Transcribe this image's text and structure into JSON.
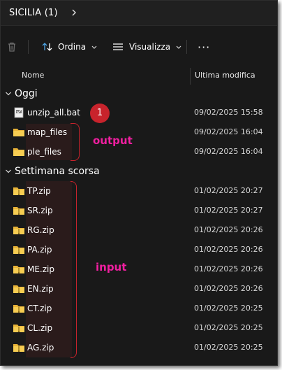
{
  "breadcrumb": {
    "folder": "SICILIA (1)"
  },
  "toolbar": {
    "sort_label": "Ordina",
    "view_label": "Visualizza",
    "more_label": "···"
  },
  "columns": {
    "name": "Nome",
    "modified": "Ultima modifica"
  },
  "groups": [
    {
      "label": "Oggi",
      "items": [
        {
          "name": "unzip_all.bat",
          "date": "09/02/2025 15:58",
          "icon": "bat-file-icon"
        },
        {
          "name": "map_files",
          "date": "09/02/2025 16:04",
          "icon": "folder-icon"
        },
        {
          "name": "ple_files",
          "date": "09/02/2025 16:04",
          "icon": "folder-icon"
        }
      ]
    },
    {
      "label": "Settimana scorsa",
      "items": [
        {
          "name": "TP.zip",
          "date": "01/02/2025 20:27",
          "icon": "zip-folder-icon"
        },
        {
          "name": "SR.zip",
          "date": "01/02/2025 20:27",
          "icon": "zip-folder-icon"
        },
        {
          "name": "RG.zip",
          "date": "01/02/2025 20:26",
          "icon": "zip-folder-icon"
        },
        {
          "name": "PA.zip",
          "date": "01/02/2025 20:26",
          "icon": "zip-folder-icon"
        },
        {
          "name": "ME.zip",
          "date": "01/02/2025 20:26",
          "icon": "zip-folder-icon"
        },
        {
          "name": "EN.zip",
          "date": "01/02/2025 20:26",
          "icon": "zip-folder-icon"
        },
        {
          "name": "CT.zip",
          "date": "01/02/2025 20:25",
          "icon": "zip-folder-icon"
        },
        {
          "name": "CL.zip",
          "date": "01/02/2025 20:25",
          "icon": "zip-folder-icon"
        },
        {
          "name": "AG.zip",
          "date": "01/02/2025 20:25",
          "icon": "zip-folder-icon"
        }
      ]
    }
  ],
  "annotations": {
    "step_badge": "1",
    "output_label": "output",
    "input_label": "input",
    "accent_color": "#c8232c",
    "label_color": "#f01fa0"
  }
}
